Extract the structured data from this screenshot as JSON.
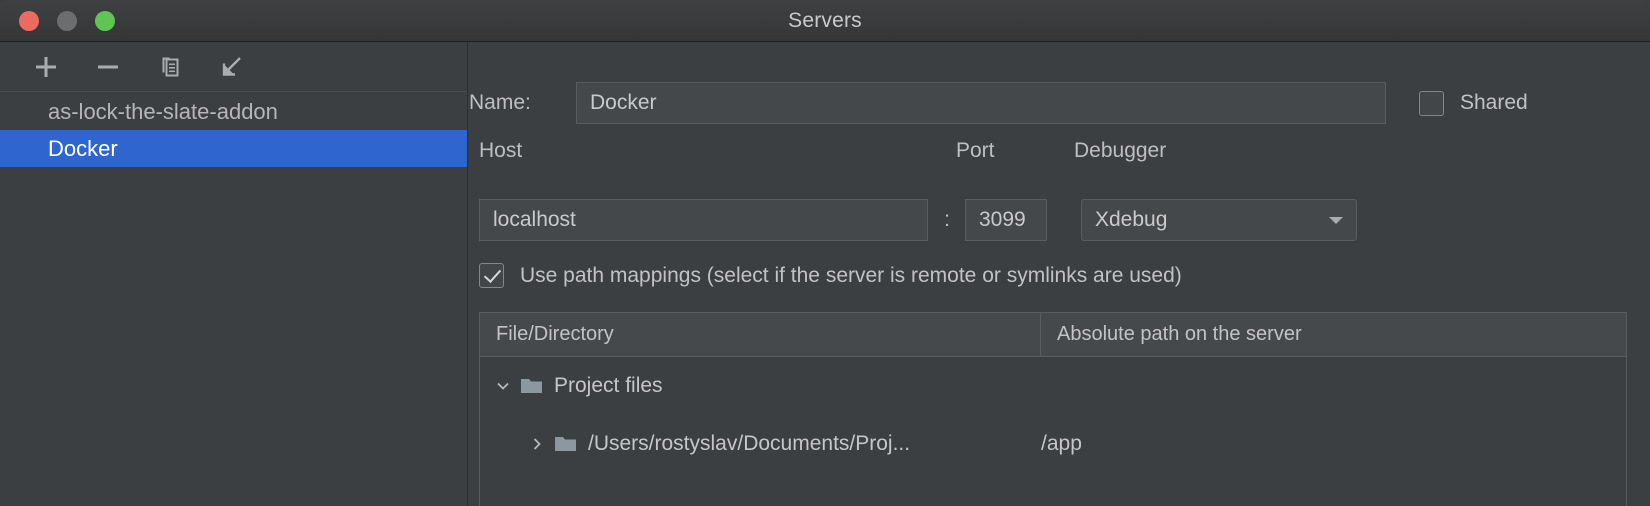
{
  "window": {
    "title": "Servers",
    "traffic_lights": [
      "close-red",
      "minimize-gray",
      "zoom-green"
    ]
  },
  "colors": {
    "window_bg": "#3c3f41",
    "titlebar_bg": "#3a3c3e",
    "selection_blue": "#2f65cf",
    "field_bg": "#45484a",
    "border": "#5a5d5f",
    "text": "#c8cacb",
    "traffic_red": "#ec6a5e",
    "traffic_yellow": "#6b6d6f",
    "traffic_green": "#61c554"
  },
  "sidebar": {
    "toolbar": [
      {
        "name": "add-server-button",
        "icon": "plus-icon"
      },
      {
        "name": "remove-server-button",
        "icon": "minus-icon"
      },
      {
        "name": "copy-server-button",
        "icon": "copy-icon"
      },
      {
        "name": "import-server-button",
        "icon": "arrow-down-left-icon"
      }
    ],
    "items": [
      {
        "label": "as-lock-the-slate-addon",
        "selected": false
      },
      {
        "label": "Docker",
        "selected": true
      }
    ]
  },
  "details": {
    "name_label": "Name:",
    "name_value": "Docker",
    "shared_label": "Shared",
    "shared_checked": false,
    "host_label": "Host",
    "port_label": "Port",
    "debugger_label": "Debugger",
    "host_value": "localhost",
    "port_separator": ":",
    "port_value": "3099",
    "debugger_value": "Xdebug",
    "use_path_mappings_label": "Use path mappings (select if the server is remote or symlinks are used)",
    "use_path_mappings_checked": true
  },
  "mappings_table": {
    "columns": [
      "File/Directory",
      "Absolute path on the server"
    ],
    "rows": [
      {
        "indent": 0,
        "expander": "chevron-down-icon",
        "file_directory": "Project files",
        "absolute_path": ""
      },
      {
        "indent": 1,
        "expander": "chevron-right-icon",
        "file_directory": "/Users/rostyslav/Documents/Proj...",
        "absolute_path": "/app"
      }
    ]
  }
}
